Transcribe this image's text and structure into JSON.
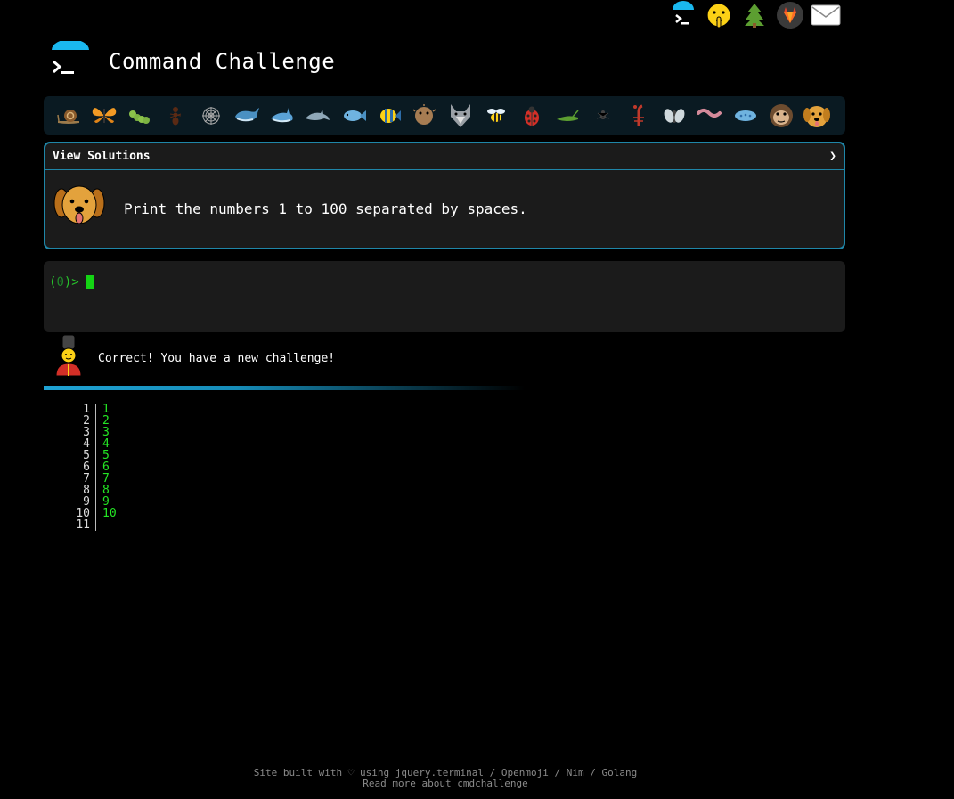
{
  "app": {
    "title": "Command Challenge"
  },
  "top_icons": [
    {
      "name": "terminal-logo-icon"
    },
    {
      "name": "shushing-face-icon"
    },
    {
      "name": "tree-icon"
    },
    {
      "name": "gitlab-icon"
    },
    {
      "name": "mail-icon"
    }
  ],
  "animals": [
    "snail",
    "butterfly",
    "caterpillar",
    "ant",
    "spider-web",
    "whale",
    "shark",
    "dolphin",
    "fish",
    "tropical-fish",
    "pufferfish",
    "wolf",
    "bee",
    "ladybug",
    "cricket",
    "spider",
    "scorpion",
    "fly",
    "worm",
    "microbe",
    "monkey",
    "dog"
  ],
  "challenge": {
    "header_label": "View Solutions",
    "chevron": "❯",
    "text": "Print the numbers 1 to 100 separated by spaces."
  },
  "terminal": {
    "prompt_open": "(",
    "prompt_code": "0",
    "prompt_close": ")>"
  },
  "feedback": {
    "message": "Correct! You have a new challenge!"
  },
  "output": {
    "line_numbers": [
      "1",
      "2",
      "3",
      "4",
      "5",
      "6",
      "7",
      "8",
      "9",
      "10",
      "11"
    ],
    "lines": [
      "1",
      "2",
      "3",
      "4",
      "5",
      "6",
      "7",
      "8",
      "9",
      "10",
      ""
    ]
  },
  "footer": {
    "line1": "Site built with ♡ using jquery.terminal / Openmoji / Nim / Golang",
    "line2": "Read more about cmdchallenge"
  },
  "colors": {
    "accent": "#1f86a8",
    "prompt_green": "#27c32b",
    "output_green": "#24e524"
  }
}
